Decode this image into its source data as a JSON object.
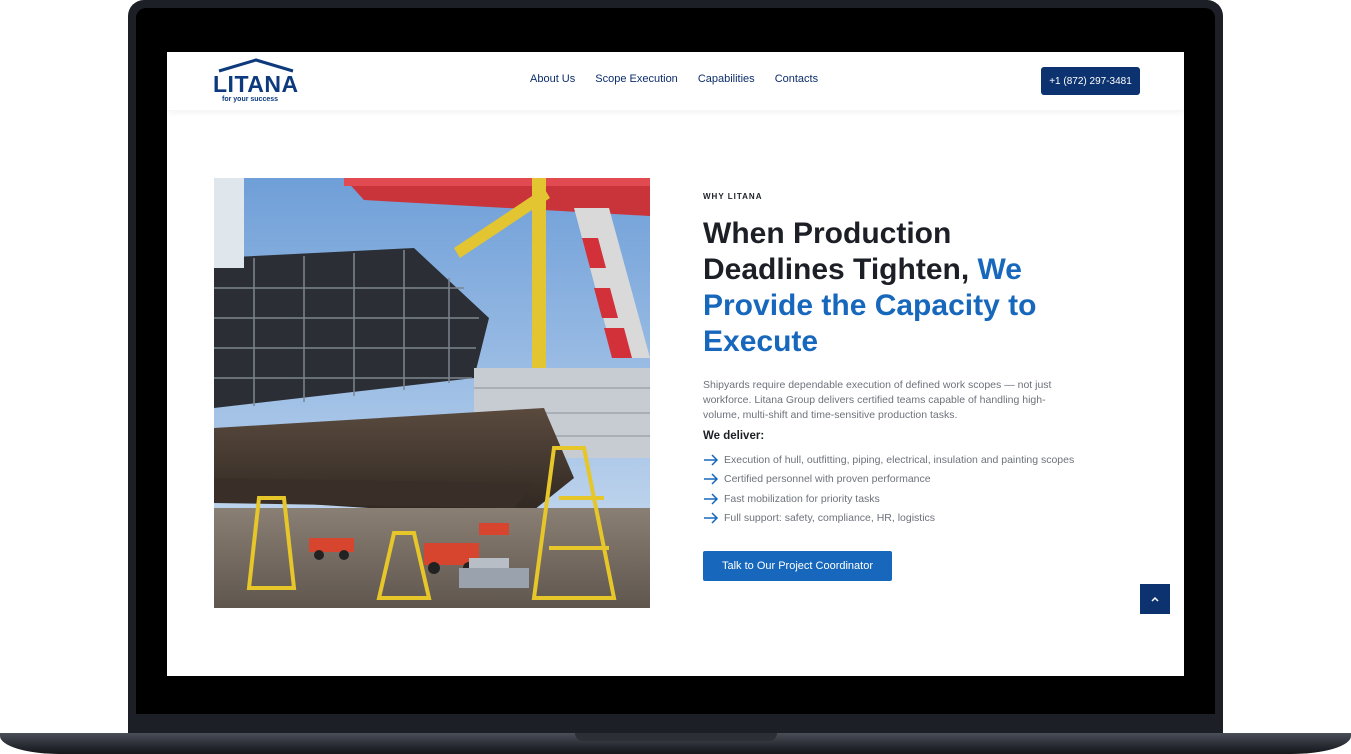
{
  "brand": {
    "name": "LITANA",
    "tagline": "for your success"
  },
  "nav": {
    "items": [
      {
        "label": "About Us"
      },
      {
        "label": "Scope Execution"
      },
      {
        "label": "Capabilities"
      },
      {
        "label": "Contacts"
      }
    ],
    "phone": "+1 (872) 297-3481"
  },
  "hero": {
    "image_icon": "shipyard-photo",
    "eyebrow": "WHY LITANA",
    "headline_dark": "When Production Deadlines Tighten, ",
    "headline_accent": "We Provide the Capacity to Execute",
    "lede": "Shipyards require dependable execution of defined work scopes — not just workforce. Litana Group delivers certified teams capable of handling high-volume, multi-shift and time-sensitive production tasks.",
    "deliver_title": "We deliver:",
    "deliver_items": [
      {
        "text": "Execution of hull, outfitting, piping, electrical, insulation and painting scopes"
      },
      {
        "text": "Certified personnel with proven performance"
      },
      {
        "text": "Fast mobilization for priority tasks"
      },
      {
        "text": "Full support: safety, compliance, HR, logistics"
      }
    ],
    "cta_label": "Talk to Our Project Coordinator"
  },
  "icons": {
    "list_bullet": "arrow-right-icon",
    "scroll_top": "chevron-up-icon"
  },
  "colors": {
    "brand_navy": "#0c3370",
    "accent_blue": "#1768bd",
    "text_dark": "#1c1f26",
    "text_muted": "#6d727b"
  }
}
